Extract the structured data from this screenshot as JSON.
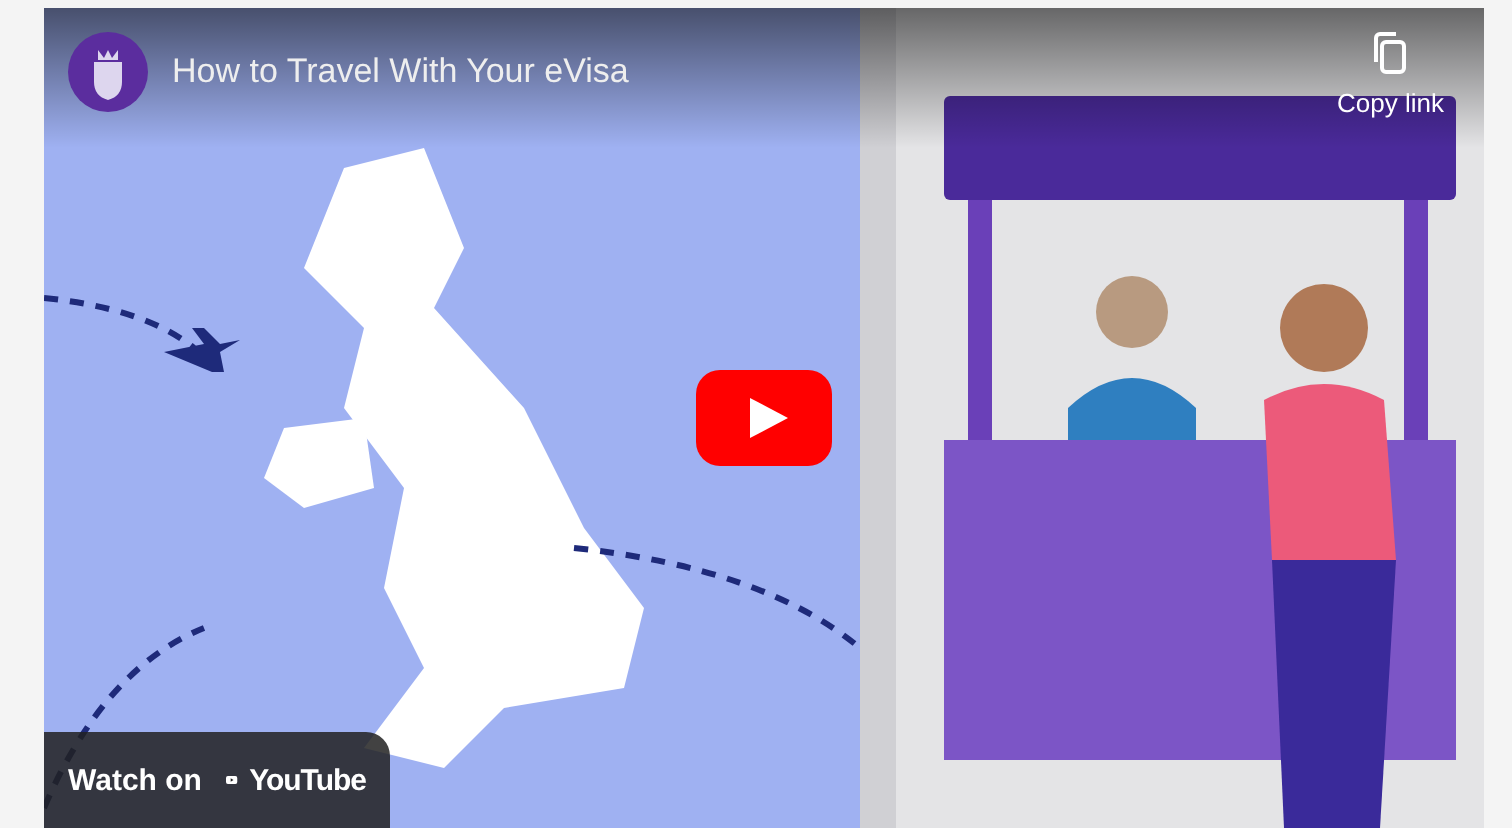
{
  "video": {
    "kind": "picture",
    "title": "How to Travel With Your eVisa",
    "copy_link": "Copy link",
    "watch_on": "Watch on",
    "brand": "YouTube"
  }
}
